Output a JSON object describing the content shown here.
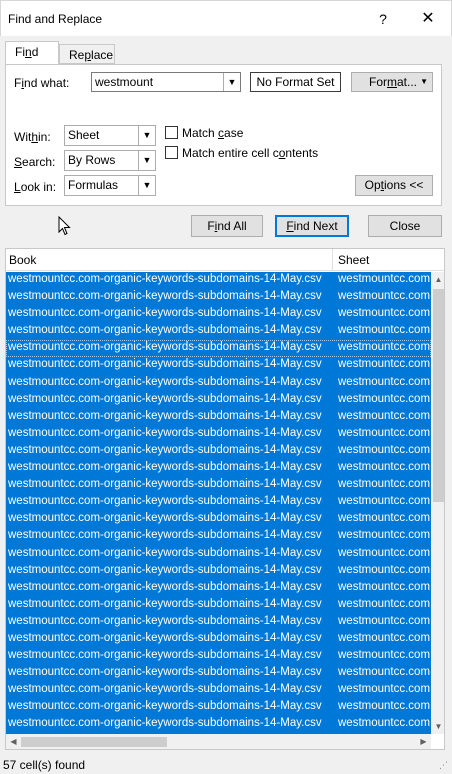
{
  "window": {
    "title": "Find and Replace",
    "help_label": "?",
    "close_label": "✕"
  },
  "tabs": {
    "find": {
      "prefix": "Fi",
      "u": "n",
      "suffix": "d"
    },
    "replace": {
      "prefix": "Re",
      "u": "p",
      "suffix": "lace"
    }
  },
  "find_what": {
    "label_prefix": "F",
    "label_u": "i",
    "label_suffix": "nd what:",
    "value": "westmount"
  },
  "format": {
    "no_format_label": "No Format Set",
    "button_prefix": "For",
    "button_u": "m",
    "button_suffix": "at...",
    "button_arrow": "▼"
  },
  "within": {
    "label_prefix": "Wit",
    "label_u": "h",
    "label_suffix": "in:",
    "value": "Sheet"
  },
  "search": {
    "label_prefix": "",
    "label_u": "S",
    "label_suffix": "earch:",
    "value": "By Rows"
  },
  "look_in": {
    "label_prefix": "",
    "label_u": "L",
    "label_suffix": "ook in:",
    "value": "Formulas"
  },
  "match_case": {
    "label_prefix": "Match ",
    "label_u": "c",
    "label_suffix": "ase",
    "checked": false
  },
  "match_entire": {
    "label_prefix": "Match entire cell c",
    "label_u": "o",
    "label_suffix": "ntents",
    "checked": false
  },
  "options_button": {
    "label_prefix": "Op",
    "label_u": "t",
    "label_suffix": "ions <<"
  },
  "actions": {
    "find_all": {
      "prefix": "F",
      "u": "i",
      "suffix": "nd All"
    },
    "find_next": {
      "prefix": "",
      "u": "F",
      "suffix": "ind Next"
    },
    "close": "Close"
  },
  "results": {
    "columns": [
      "Book",
      "Sheet"
    ],
    "rows": [
      [
        "westmountcc.com-organic-keywords-subdomains-14-May.csv",
        "westmountcc.com"
      ],
      [
        "westmountcc.com-organic-keywords-subdomains-14-May.csv",
        "westmountcc.com"
      ],
      [
        "westmountcc.com-organic-keywords-subdomains-14-May.csv",
        "westmountcc.com"
      ],
      [
        "westmountcc.com-organic-keywords-subdomains-14-May.csv",
        "westmountcc.com"
      ],
      [
        "westmountcc.com-organic-keywords-subdomains-14-May.csv",
        "westmountcc.com"
      ],
      [
        "westmountcc.com-organic-keywords-subdomains-14-May.csv",
        "westmountcc.com"
      ],
      [
        "westmountcc.com-organic-keywords-subdomains-14-May.csv",
        "westmountcc.com"
      ],
      [
        "westmountcc.com-organic-keywords-subdomains-14-May.csv",
        "westmountcc.com"
      ],
      [
        "westmountcc.com-organic-keywords-subdomains-14-May.csv",
        "westmountcc.com"
      ],
      [
        "westmountcc.com-organic-keywords-subdomains-14-May.csv",
        "westmountcc.com"
      ],
      [
        "westmountcc.com-organic-keywords-subdomains-14-May.csv",
        "westmountcc.com"
      ],
      [
        "westmountcc.com-organic-keywords-subdomains-14-May.csv",
        "westmountcc.com"
      ],
      [
        "westmountcc.com-organic-keywords-subdomains-14-May.csv",
        "westmountcc.com"
      ],
      [
        "westmountcc.com-organic-keywords-subdomains-14-May.csv",
        "westmountcc.com"
      ],
      [
        "westmountcc.com-organic-keywords-subdomains-14-May.csv",
        "westmountcc.com"
      ],
      [
        "westmountcc.com-organic-keywords-subdomains-14-May.csv",
        "westmountcc.com"
      ],
      [
        "westmountcc.com-organic-keywords-subdomains-14-May.csv",
        "westmountcc.com"
      ],
      [
        "westmountcc.com-organic-keywords-subdomains-14-May.csv",
        "westmountcc.com"
      ],
      [
        "westmountcc.com-organic-keywords-subdomains-14-May.csv",
        "westmountcc.com"
      ],
      [
        "westmountcc.com-organic-keywords-subdomains-14-May.csv",
        "westmountcc.com"
      ],
      [
        "westmountcc.com-organic-keywords-subdomains-14-May.csv",
        "westmountcc.com"
      ],
      [
        "westmountcc.com-organic-keywords-subdomains-14-May.csv",
        "westmountcc.com"
      ],
      [
        "westmountcc.com-organic-keywords-subdomains-14-May.csv",
        "westmountcc.com"
      ],
      [
        "westmountcc.com-organic-keywords-subdomains-14-May.csv",
        "westmountcc.com"
      ],
      [
        "westmountcc.com-organic-keywords-subdomains-14-May.csv",
        "westmountcc.com"
      ],
      [
        "westmountcc.com-organic-keywords-subdomains-14-May.csv",
        "westmountcc.com"
      ],
      [
        "westmountcc.com-organic-keywords-subdomains-14-May.csv",
        "westmountcc.com"
      ]
    ]
  },
  "status": {
    "text": "57 cell(s) found"
  },
  "icons": {
    "dropdown": "chevron-down-icon",
    "scroll_up": "▲",
    "scroll_down": "▼",
    "scroll_left": "◀",
    "scroll_right": "▶"
  }
}
